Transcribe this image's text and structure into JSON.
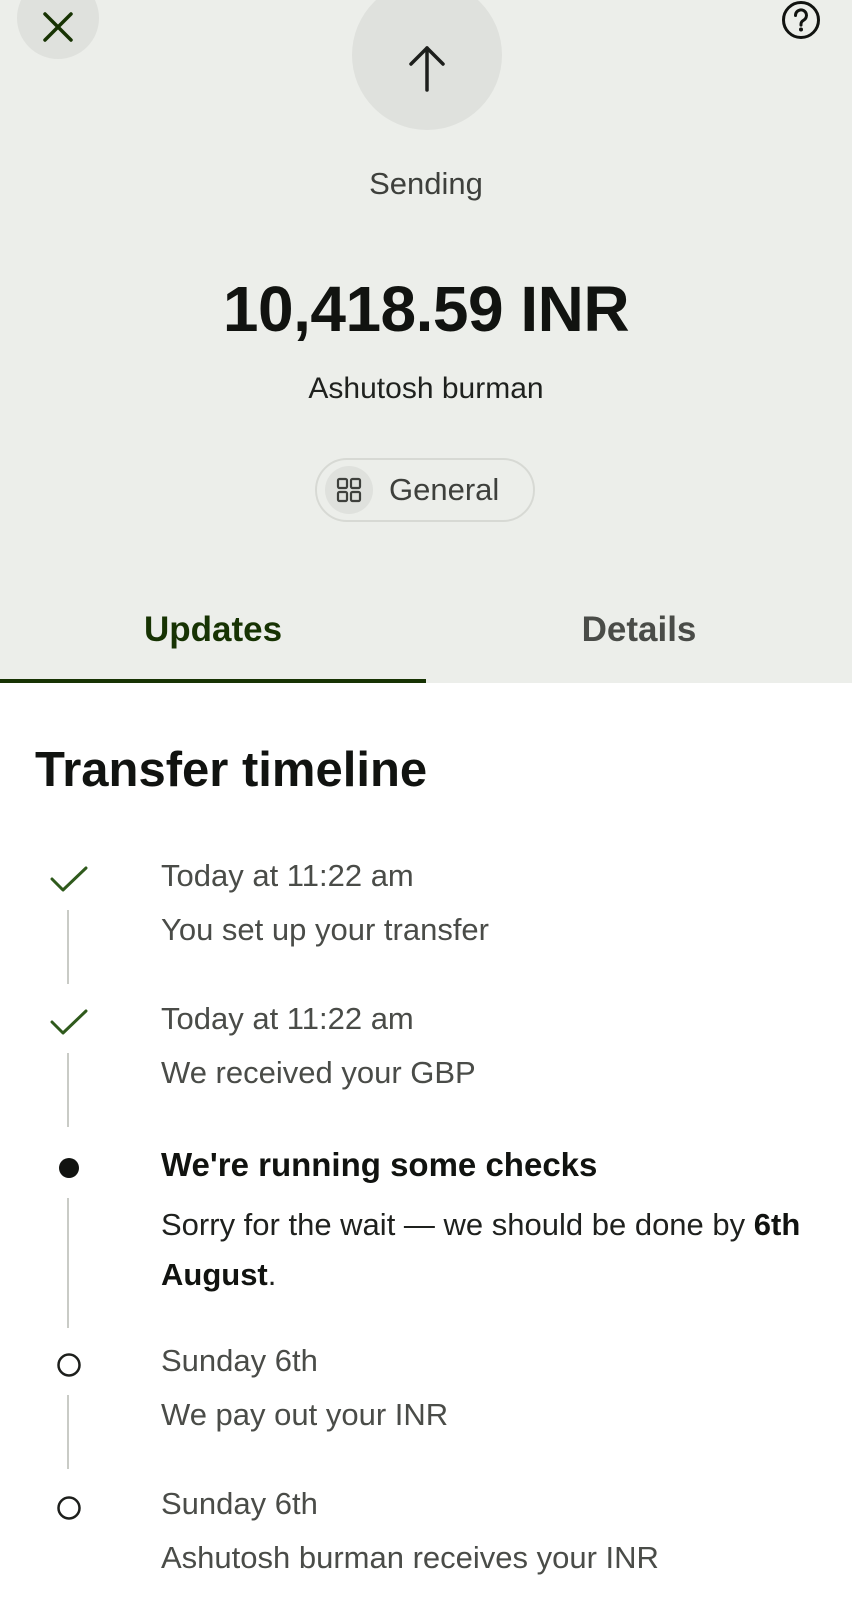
{
  "header": {
    "status": "Sending",
    "amount": "10,418.59 INR",
    "recipient": "Ashutosh burman",
    "category": "General",
    "close_icon": "close-icon",
    "help_icon": "help-icon",
    "status_icon": "arrow-up-icon"
  },
  "tabs": [
    {
      "label": "Updates",
      "active": true
    },
    {
      "label": "Details",
      "active": false
    }
  ],
  "timeline": {
    "title": "Transfer timeline",
    "items": [
      {
        "state": "done",
        "date": "Today at 11:22 am",
        "desc": "You set up your transfer"
      },
      {
        "state": "done",
        "date": "Today at 11:22 am",
        "desc": "We received your GBP"
      },
      {
        "state": "current",
        "title": "We're running some checks",
        "desc": "Sorry for the wait — we should be done by",
        "desc_bold": "6th August",
        "desc_suffix": "."
      },
      {
        "state": "pending",
        "date": "Sunday 6th",
        "desc": "We pay out your INR"
      },
      {
        "state": "pending",
        "date": "Sunday 6th",
        "desc": "Ashutosh burman receives your INR"
      }
    ]
  },
  "colors": {
    "header_bg": "#eceeea",
    "accent": "#173303",
    "check": "#2f5a1c"
  }
}
